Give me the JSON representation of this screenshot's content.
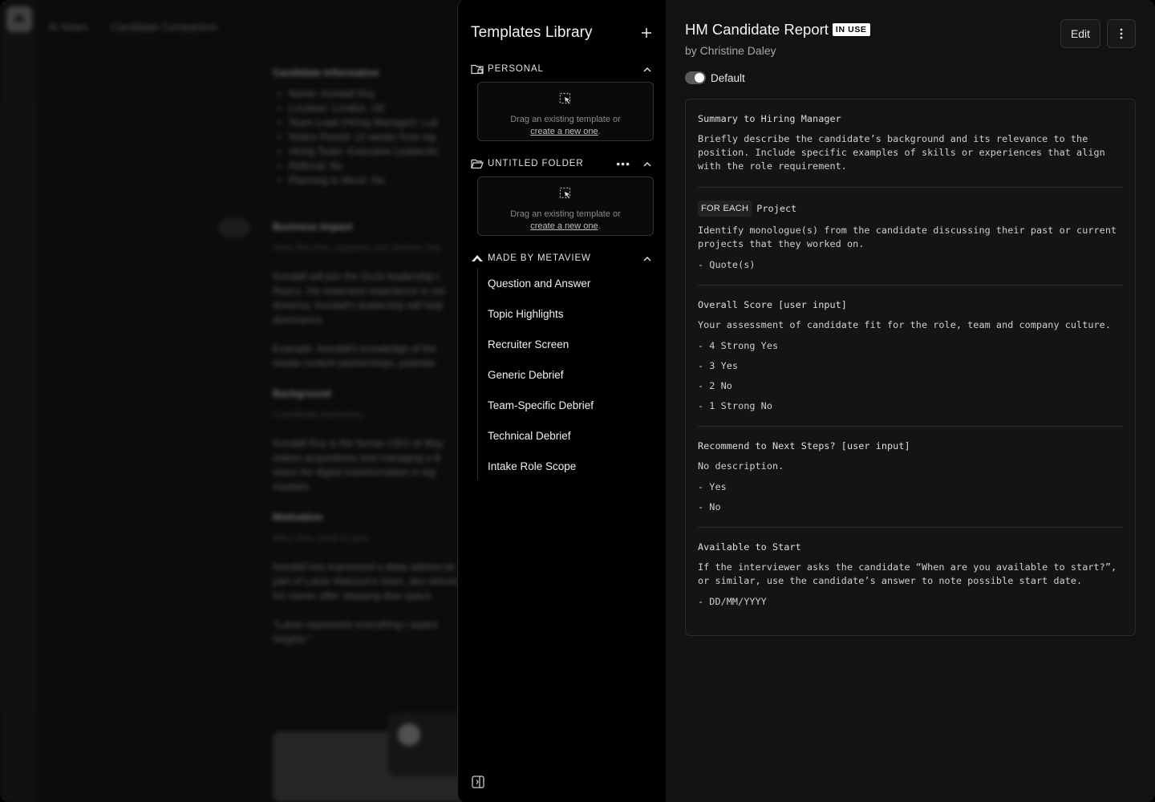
{
  "background": {
    "breadcrumbs": [
      "AI Notes",
      "Candidate Comparison"
    ],
    "doc": {
      "candidate_info_heading": "Candidate Information",
      "info_items": [
        "Name: Kendall Roy",
        "Location: London, UK",
        "Team Lead (Hiring Manager): Luk",
        "Notice Period: 12 weeks from sig",
        "Hiring Team: Executive Leadershi",
        "Referral: No",
        "Planning to Move: No"
      ],
      "business_heading": "Business Impact",
      "business_sub": "How this hire supports our bottom line",
      "business_p1": "Kendall will join the GoJo leadership t Royco. His extensive experience in me America. Kendall's leadership will help dominance.",
      "business_p2": "Example: Kendall's knowledge of the media content partnerships, potentia",
      "background_heading": "Background",
      "background_sub": "Candidate backstory",
      "background_p": "Kendall Roy is the former CEO of Way stakes acquisitions and managing a $ vision for digital transformation in leg markets.",
      "motivation_heading": "Motivation",
      "motivation_sub": "Why they want to join",
      "motivation_p1": "Kendall has expressed a deep admira be part of Lukas Matsson's team, des reinvent his career after stepping dow space.",
      "motivation_p2": "\"Lukas represents everything I aspire heights.\""
    }
  },
  "library": {
    "title": "Templates Library",
    "sections": {
      "personal": {
        "label": "PERSONAL"
      },
      "untitled": {
        "label": "UNTITLED FOLDER"
      },
      "metaview": {
        "label": "MADE BY METAVIEW"
      }
    },
    "dropzone": {
      "text": "Drag an existing template or",
      "link": "create a new one",
      "suffix": "."
    },
    "templates": [
      "Question and Answer",
      "Topic Highlights",
      "Recruiter Screen",
      "Generic Debrief",
      "Team-Specific Debrief",
      "Technical Debrief",
      "Intake Role Scope"
    ]
  },
  "report": {
    "title": "HM Candidate Report",
    "badge": "IN USE",
    "author": "by Christine Daley",
    "edit_label": "Edit",
    "toggle_label": "Default",
    "toggle_on": true,
    "sections": [
      {
        "title": "Summary to Hiring Manager",
        "desc": "Briefly describe the candidate’s background and its relevance to the position. Include specific examples of skills or experiences that align with the role requirement.",
        "options": []
      },
      {
        "tag": "FOR EACH",
        "title": "Project",
        "desc": "Identify monologue(s) from the candidate discussing their past or current projects that they worked on.",
        "options": [
          "- Quote(s)"
        ]
      },
      {
        "title": "Overall Score [user input]",
        "desc": "Your assessment of candidate fit for the role, team and company culture.",
        "options": [
          "- 4 Strong Yes",
          "- 3 Yes",
          "- 2 No",
          "- 1 Strong No"
        ]
      },
      {
        "title": "Recommend to Next Steps? [user input]",
        "desc": "No description.",
        "options": [
          "- Yes",
          "- No"
        ]
      },
      {
        "title": "Available to Start",
        "desc": "If the interviewer asks the candidate “When are you available to start?”, or similar, use the candidate’s answer to note possible start date.",
        "options": [
          "- DD/MM/YYYY"
        ]
      }
    ]
  }
}
